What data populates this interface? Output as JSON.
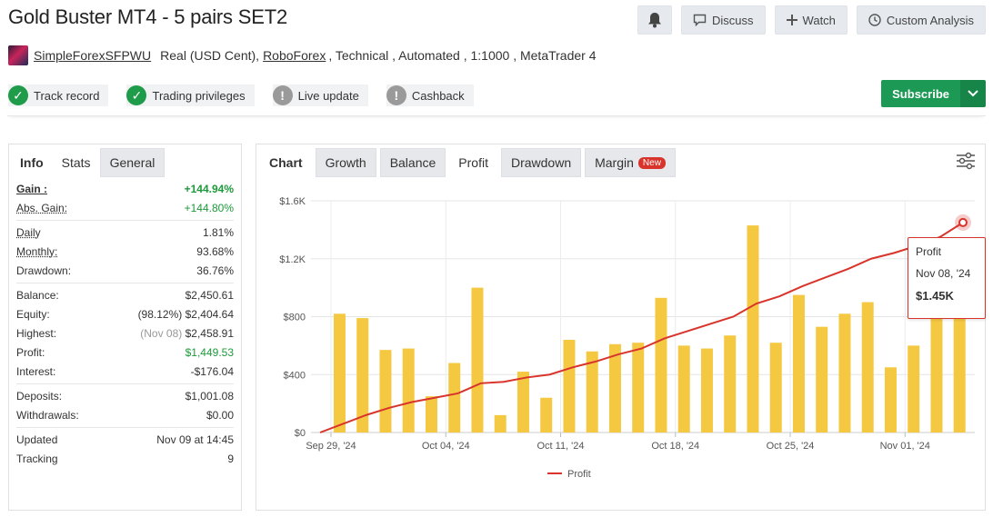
{
  "title": "Gold Buster MT4 - 5 pairs SET2",
  "actions": {
    "discuss": "Discuss",
    "watch": "Watch",
    "analysis": "Custom Analysis"
  },
  "account": {
    "user": "SimpleForexSFPWU",
    "type": "Real (USD Cent),",
    "broker": "RoboForex",
    "details": ", Technical , Automated , 1:1000 , MetaTrader 4"
  },
  "badges": [
    "Track record",
    "Trading privileges",
    "Live update",
    "Cashback"
  ],
  "subscribe": "Subscribe",
  "left_tabs": [
    "Info",
    "Stats",
    "General"
  ],
  "stats": {
    "gain_label": "Gain :",
    "gain": "+144.94%",
    "abs_gain_label": "Abs. Gain:",
    "abs_gain": "+144.80%",
    "daily_label": "Daily",
    "daily": "1.81%",
    "monthly_label": "Monthly:",
    "monthly": "93.68%",
    "drawdown_label": "Drawdown:",
    "drawdown": "36.76%",
    "balance_label": "Balance:",
    "balance": "$2,450.61",
    "equity_label": "Equity:",
    "equity_pct": "(98.12%)",
    "equity": "$2,404.64",
    "highest_label": "Highest:",
    "highest_date": "(Nov 08)",
    "highest": "$2,458.91",
    "profit_label": "Profit:",
    "profit": "$1,449.53",
    "interest_label": "Interest:",
    "interest": "-$176.04",
    "deposits_label": "Deposits:",
    "deposits": "$1,001.08",
    "withdrawals_label": "Withdrawals:",
    "withdrawals": "$0.00",
    "updated_label": "Updated",
    "updated": "Nov 09 at 14:45",
    "tracking_label": "Tracking",
    "tracking": "9"
  },
  "chart_tabs": [
    "Chart",
    "Growth",
    "Balance",
    "Profit",
    "Drawdown",
    "Margin"
  ],
  "new_badge": "New",
  "tooltip": {
    "series": "Profit",
    "date": "Nov 08, '24",
    "value": "$1.45K"
  },
  "colors": {
    "bar": "#f5c842",
    "line": "#d9342b",
    "accent": "#1c9a55"
  },
  "chart_data": {
    "type": "bar+line",
    "ylim": [
      0,
      1600
    ],
    "y_ticks": [
      "$0",
      "$400",
      "$800",
      "$1.2K",
      "$1.6K"
    ],
    "y_tick_values": [
      0,
      400,
      800,
      1200,
      1600
    ],
    "x_ticks": [
      "Sep 29, '24",
      "Oct 04, '24",
      "Oct 11, '24",
      "Oct 18, '24",
      "Oct 25, '24",
      "Nov 01, '24"
    ],
    "x_tick_index": [
      0,
      5,
      10,
      15,
      20,
      25
    ],
    "bar_values": [
      820,
      790,
      570,
      580,
      250,
      480,
      1000,
      120,
      420,
      240,
      640,
      560,
      610,
      620,
      930,
      600,
      580,
      670,
      1430,
      620,
      950,
      730,
      820,
      900,
      450,
      600,
      800,
      900
    ],
    "series": [
      {
        "name": "Profit",
        "values": [
          0,
          60,
          120,
          170,
          210,
          240,
          270,
          340,
          350,
          380,
          400,
          450,
          490,
          540,
          580,
          650,
          700,
          750,
          800,
          890,
          940,
          1010,
          1070,
          1130,
          1200,
          1240,
          1290,
          1350,
          1450
        ]
      }
    ],
    "legend": "bottom-center"
  }
}
